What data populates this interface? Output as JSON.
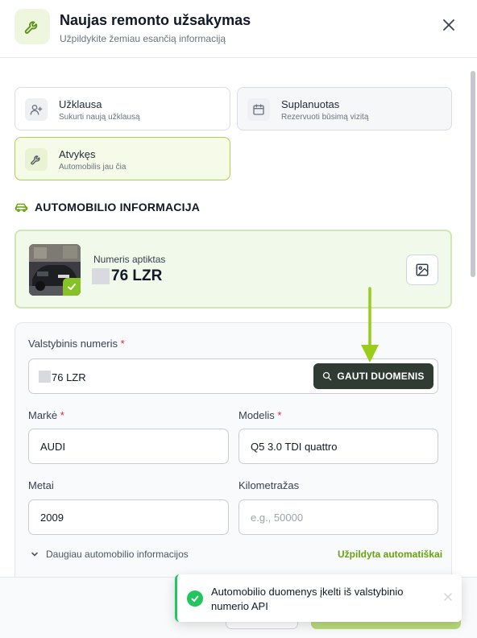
{
  "header": {
    "title": "Naujas remonto užsakymas",
    "subtitle": "Užpildykite žemiau esančią informaciją"
  },
  "order_types": [
    {
      "title": "Užklausa",
      "subtitle": "Sukurti naują užklausą",
      "icon": "user-plus-icon",
      "state": "default"
    },
    {
      "title": "Suplanuotas",
      "subtitle": "Rezervuoti būsimą vizitą",
      "icon": "calendar-icon",
      "state": "muted"
    },
    {
      "title": "Atvykęs",
      "subtitle": "Automobilis jau čia",
      "icon": "wrench-icon",
      "state": "selected"
    }
  ],
  "vehicle_section": {
    "title": "AUTOMOBILIO INFORMACIJA",
    "icon": "car-icon"
  },
  "detection": {
    "label": "Numeris aptiktas",
    "plate": "76 LZR"
  },
  "form": {
    "plate_label": "Valstybinis numeris",
    "plate_value": "76 LZR",
    "fetch_button": "GAUTI DUOMENIS",
    "make_label": "Markė",
    "make_value": "AUDI",
    "model_label": "Modelis",
    "model_value": "Q5 3.0 TDI quattro",
    "year_label": "Metai",
    "year_value": "2009",
    "mileage_label": "Kilometražas",
    "mileage_placeholder": "e.g., 50000",
    "required_marker": "*",
    "more_toggle": "Daugiau automobilio informacijos",
    "autofill_status": "Užpildyta automatiškai"
  },
  "toast": {
    "message": "Automobilio duomenys įkelti iš valstybinio numerio API"
  },
  "colors": {
    "accent": "#84c225",
    "dark_button": "#2f3b33",
    "success": "#22c55e",
    "arrow": "#9acd1a"
  }
}
